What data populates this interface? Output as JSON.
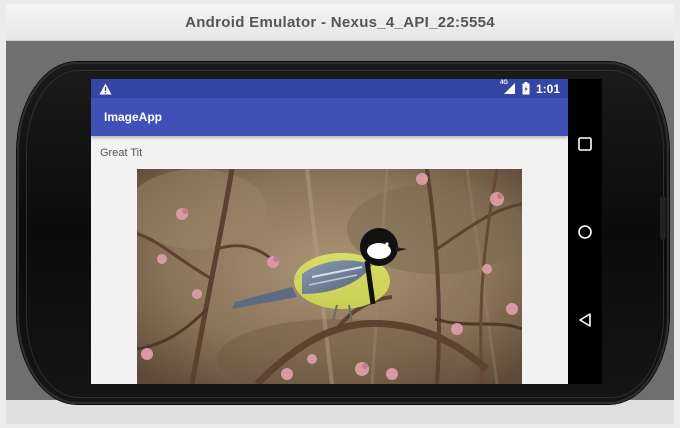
{
  "window": {
    "title": "Android Emulator - Nexus_4_API_22:5554"
  },
  "statusbar": {
    "warning_icon": "warning-icon",
    "network_label": "4G",
    "signal_icon": "signal-icon",
    "battery_icon": "battery-icon",
    "time": "1:01",
    "bg_color": "#3346a3"
  },
  "appbar": {
    "title": "ImageApp",
    "bg_color": "#3f51b5"
  },
  "content": {
    "image_title": "Great Tit",
    "image_icon": "great-tit-photo"
  },
  "navbar": {
    "recents_icon": "square-recents-icon",
    "home_icon": "circle-home-icon",
    "back_icon": "triangle-back-icon"
  }
}
